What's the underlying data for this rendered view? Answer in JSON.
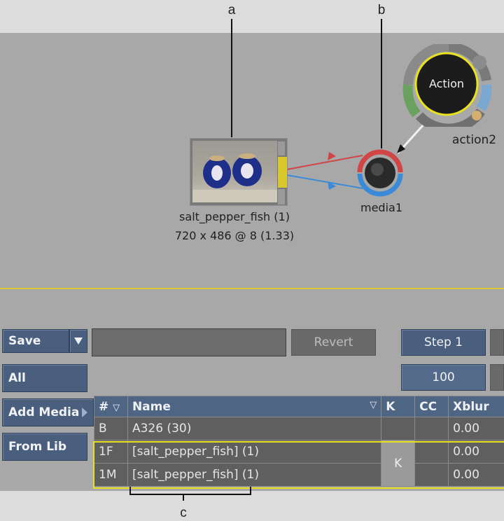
{
  "callouts": {
    "a": "a",
    "b": "b",
    "c": "c"
  },
  "nodes": {
    "clip": {
      "name": "salt_pepper_fish (1)",
      "resolution": "720 x 486 @ 8 (1.33)"
    },
    "media": {
      "label": "media1"
    },
    "action": {
      "button_label": "Action",
      "label": "action2"
    }
  },
  "toolbar": {
    "save_label": "Save",
    "revert_label": "Revert",
    "step_label": "Step 1",
    "value": "100"
  },
  "side_buttons": {
    "all": "All",
    "add_media": "Add Media",
    "from_lib": "From Lib"
  },
  "media_table": {
    "headers": {
      "num": "#",
      "name": "Name",
      "k": "K",
      "cc": "CC",
      "xblur": "Xblur"
    },
    "rows": [
      {
        "num": "B",
        "name": "A326 (30)",
        "k": "",
        "cc": "",
        "xblur": "0.00"
      },
      {
        "num": "1F",
        "name": "[salt_pepper_fish] (1)",
        "k": "K",
        "cc": "",
        "xblur": "0.00"
      },
      {
        "num": "1M",
        "name": "[salt_pepper_fish] (1)",
        "k": "",
        "cc": "",
        "xblur": "0.00"
      }
    ]
  },
  "colors": {
    "accent_yellow": "#e8e020",
    "button_blue": "#4a5f7e",
    "red_link": "#d04040",
    "blue_link": "#3a8ad8"
  }
}
